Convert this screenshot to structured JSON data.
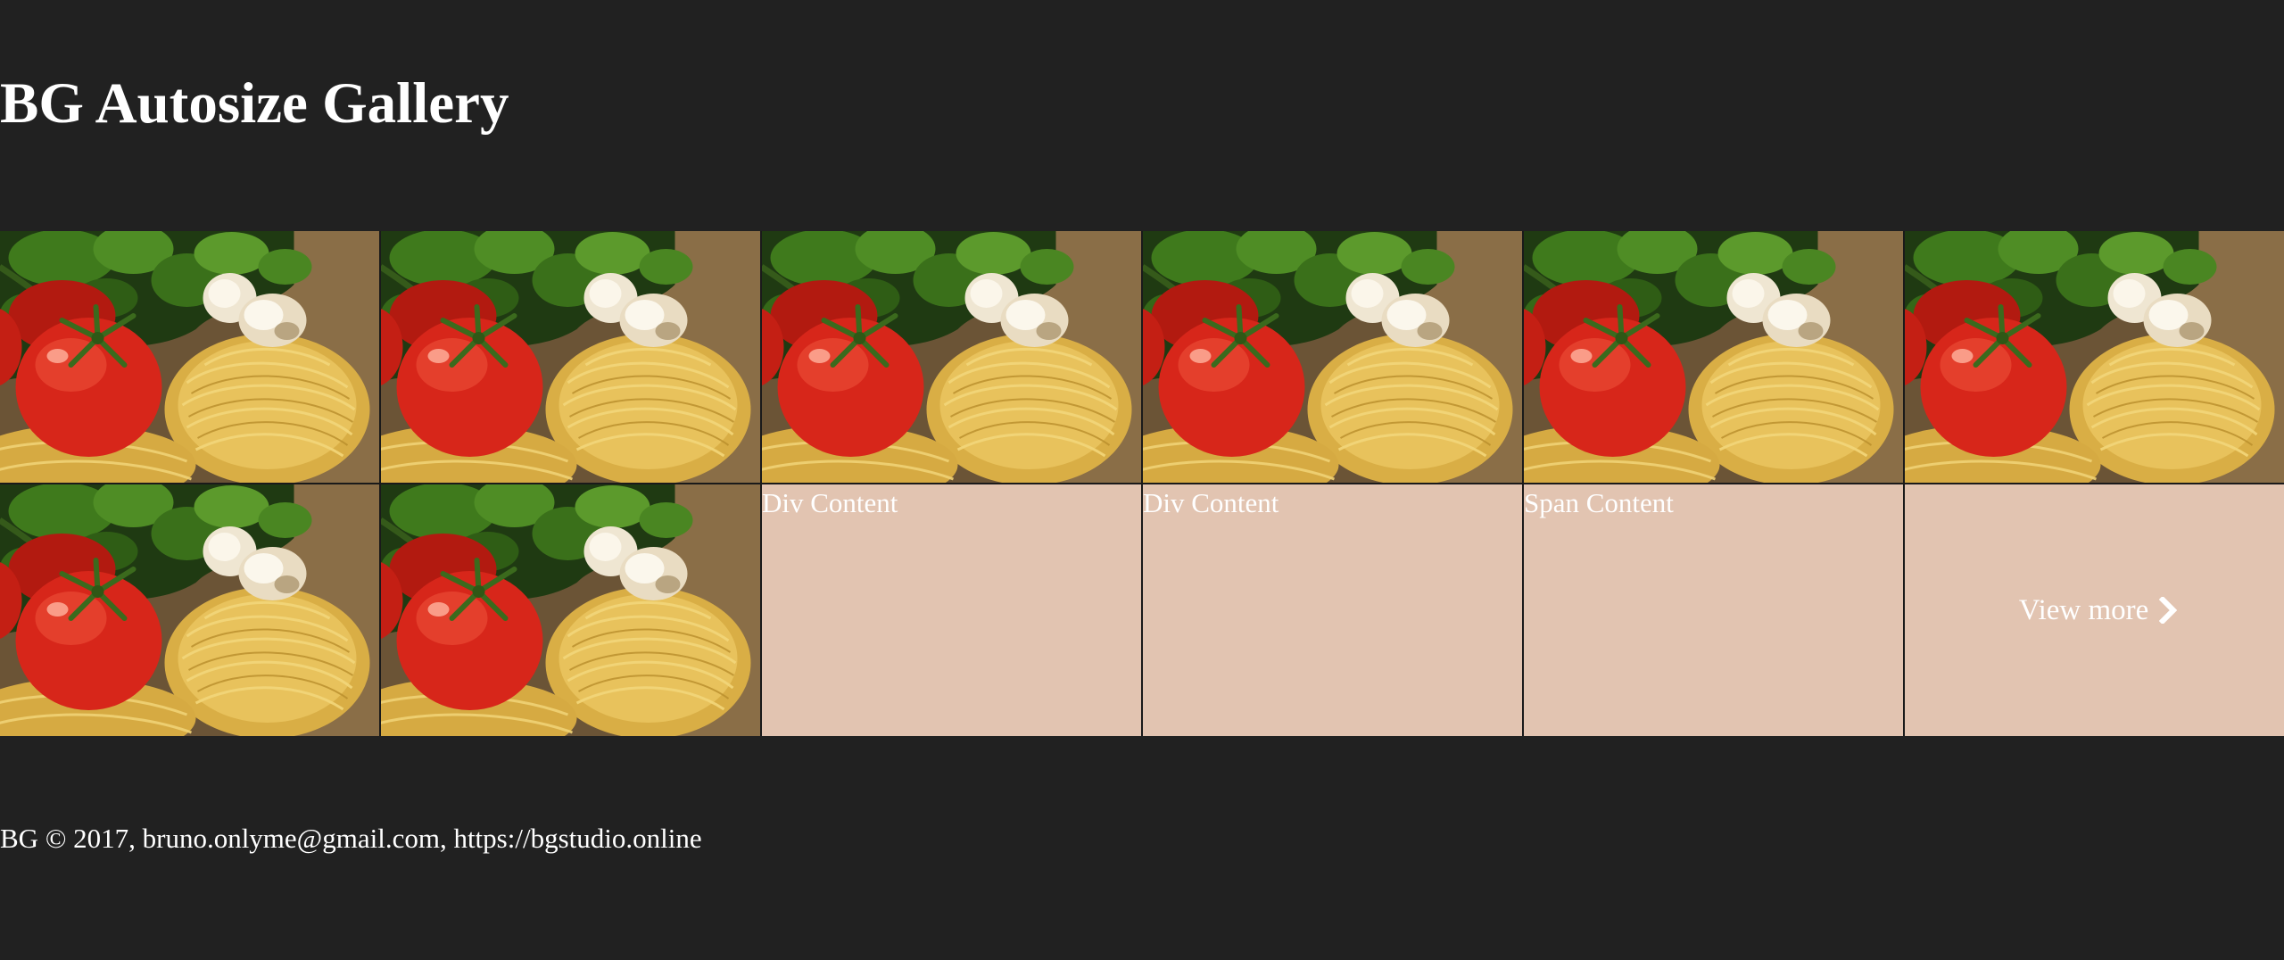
{
  "header": {
    "title": "BG Autosize Gallery"
  },
  "gallery": {
    "photo_tiles": [
      {
        "icon": "pasta-tomato-garlic-photo"
      },
      {
        "icon": "pasta-tomato-garlic-photo"
      },
      {
        "icon": "pasta-tomato-garlic-photo"
      },
      {
        "icon": "pasta-tomato-garlic-photo"
      },
      {
        "icon": "pasta-tomato-garlic-photo"
      },
      {
        "icon": "pasta-tomato-garlic-photo"
      },
      {
        "icon": "pasta-tomato-garlic-photo"
      },
      {
        "icon": "pasta-tomato-garlic-photo"
      }
    ],
    "content_tiles": [
      {
        "label": "Div Content"
      },
      {
        "label": "Div Content"
      },
      {
        "label": "Span Content"
      }
    ],
    "view_more_label": "View more",
    "tile_color": "#e2c4b1"
  },
  "footer": {
    "text": "BG © 2017, bruno.onlyme@gmail.com, https://bgstudio.online"
  },
  "colors": {
    "background": "#212121",
    "text": "#ffffff"
  }
}
